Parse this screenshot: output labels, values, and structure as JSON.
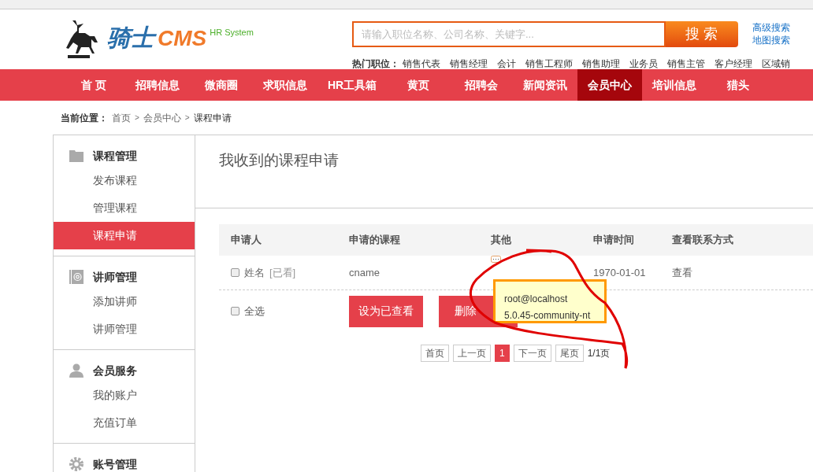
{
  "header": {
    "logo": {
      "brand": "骑士",
      "suffix": "CMS",
      "tagline": "HR System"
    },
    "search": {
      "placeholder": "请输入职位名称、公司名称、关键字...",
      "button": "搜 索"
    },
    "links": [
      "高级搜索",
      "地图搜索"
    ],
    "hot_label": "热门职位：",
    "hot_jobs": [
      "销售代表",
      "销售经理",
      "会计",
      "销售工程师",
      "销售助理",
      "业务员",
      "销售主管",
      "客户经理",
      "区域销"
    ]
  },
  "nav": [
    {
      "label": "首 页",
      "selected": false
    },
    {
      "label": "招聘信息",
      "selected": false
    },
    {
      "label": "微商圈",
      "selected": false
    },
    {
      "label": "求职信息",
      "selected": false
    },
    {
      "label": "HR工具箱",
      "selected": false
    },
    {
      "label": "黄页",
      "selected": false
    },
    {
      "label": "招聘会",
      "selected": false
    },
    {
      "label": "新闻资讯",
      "selected": false
    },
    {
      "label": "会员中心",
      "selected": true
    },
    {
      "label": "培训信息",
      "selected": false
    },
    {
      "label": "猎头",
      "selected": false
    }
  ],
  "breadcrumb": {
    "label": "当前位置：",
    "separator": ">",
    "items": [
      "首页",
      "会员中心",
      "课程申请"
    ]
  },
  "sidebar": [
    {
      "title": "课程管理",
      "kind": "folder",
      "items": [
        {
          "label": "发布课程",
          "selected": false
        },
        {
          "label": "管理课程",
          "selected": false
        },
        {
          "label": "课程申请",
          "selected": true
        }
      ]
    },
    {
      "title": "讲师管理",
      "kind": "contact",
      "items": [
        {
          "label": "添加讲师",
          "selected": false
        },
        {
          "label": "讲师管理",
          "selected": false
        }
      ]
    },
    {
      "title": "会员服务",
      "kind": "person",
      "items": [
        {
          "label": "我的账户",
          "selected": false
        },
        {
          "label": "充值订单",
          "selected": false
        }
      ]
    },
    {
      "title": "账号管理",
      "kind": "gear"
    }
  ],
  "content": {
    "title": "我收到的课程申请",
    "columns": [
      "申请人",
      "申请的课程",
      "其他",
      "申请时间",
      "查看联系方式"
    ],
    "rows": [
      {
        "checked": false,
        "name": "姓名",
        "status": "[已看]",
        "course": "cname",
        "date": "1970-01-01",
        "action": "查看"
      }
    ],
    "select_all": {
      "label": "全选",
      "checked": false
    },
    "buttons": [
      "设为已查看",
      "删除"
    ],
    "pagination": {
      "items": [
        {
          "label": "首页",
          "selected": false
        },
        {
          "label": "上一页",
          "selected": false
        },
        {
          "label": "1",
          "selected": true
        },
        {
          "label": "下一页",
          "selected": false
        },
        {
          "label": "尾页",
          "selected": false
        }
      ],
      "summary": "1/1页"
    },
    "tooltip": [
      "root@localhost",
      "5.0.45-community-nt"
    ]
  }
}
